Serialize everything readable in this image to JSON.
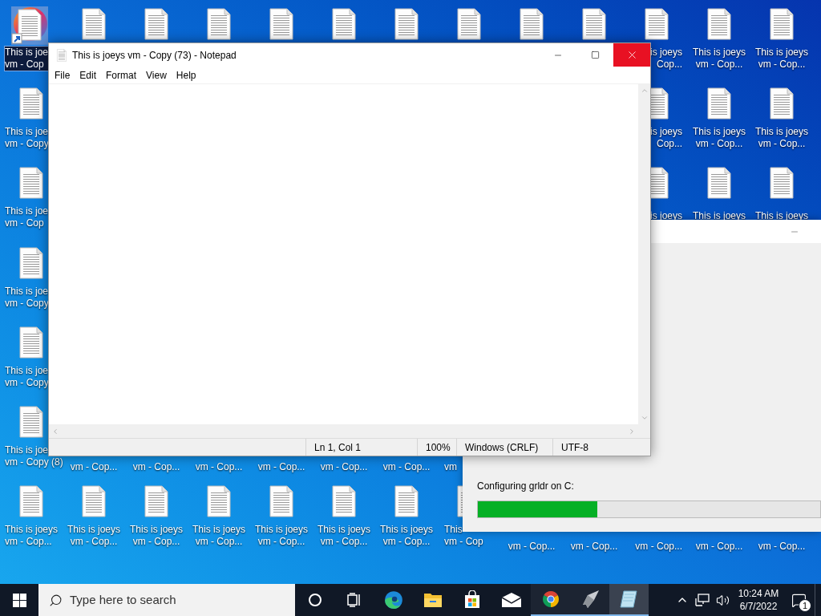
{
  "desktop": {
    "rows": [
      {
        "cells": [
          {
            "kind": "shortcut",
            "selected": true,
            "lines": [
              "This is joe",
              "vm - Cop"
            ]
          },
          {
            "kind": "file",
            "selected": false
          },
          {
            "kind": "file",
            "selected": false
          },
          {
            "kind": "file",
            "selected": false
          },
          {
            "kind": "file",
            "selected": false
          },
          {
            "kind": "file",
            "selected": false
          },
          {
            "kind": "file",
            "selected": false
          },
          {
            "kind": "file",
            "selected": false
          },
          {
            "kind": "file",
            "selected": false
          },
          {
            "kind": "file",
            "selected": false
          },
          {
            "kind": "file",
            "selected": false,
            "lines": [
              "is joeys",
              "Cop..."
            ]
          },
          {
            "kind": "file",
            "selected": false,
            "lines": [
              "This is joeys",
              "vm - Cop..."
            ]
          },
          {
            "kind": "file",
            "selected": false,
            "lines": [
              "This is joeys",
              "vm - Cop..."
            ]
          }
        ]
      },
      {
        "cells": [
          {
            "kind": "file",
            "selected": false,
            "lines": [
              "This is joe",
              "vm - Copy"
            ]
          },
          null,
          null,
          null,
          null,
          null,
          null,
          null,
          null,
          null,
          {
            "kind": "file",
            "selected": false,
            "lines": [
              "is joeys",
              "Cop..."
            ]
          },
          {
            "kind": "file",
            "selected": false,
            "lines": [
              "This is joeys",
              "vm - Cop..."
            ]
          },
          {
            "kind": "file",
            "selected": false,
            "lines": [
              "This is joeys",
              "vm - Cop..."
            ]
          }
        ]
      },
      {
        "cells": [
          {
            "kind": "file",
            "selected": false,
            "lines": [
              "This is joe",
              "vm - Cop"
            ]
          },
          null,
          null,
          null,
          null,
          null,
          null,
          null,
          null,
          null,
          {
            "kind": "file",
            "selected": false,
            "lines": [
              "is joeys"
            ]
          },
          {
            "kind": "file",
            "selected": false,
            "lines": [
              "This is joeys"
            ]
          },
          {
            "kind": "file",
            "selected": false,
            "lines": [
              "This is joeys"
            ]
          }
        ]
      },
      {
        "cells": [
          {
            "kind": "file",
            "selected": false,
            "lines": [
              "This is joe",
              "vm - Copy"
            ]
          }
        ]
      },
      {
        "cells": [
          {
            "kind": "file",
            "selected": false,
            "lines": [
              "This is joe",
              "vm - Copy"
            ]
          }
        ]
      },
      {
        "cells": [
          {
            "kind": "file",
            "selected": false,
            "lines": [
              "This is joe",
              "vm - Copy (8)"
            ]
          },
          {
            "kind": "tail",
            "selected": false,
            "lines": [
              "vm - Cop..."
            ]
          },
          {
            "kind": "tail",
            "selected": false,
            "lines": [
              "vm - Cop..."
            ]
          },
          {
            "kind": "tail",
            "selected": false,
            "lines": [
              "vm - Cop..."
            ]
          },
          {
            "kind": "tail",
            "selected": false,
            "lines": [
              "vm - Cop..."
            ]
          },
          {
            "kind": "tail",
            "selected": false,
            "lines": [
              "vm - Cop..."
            ]
          },
          {
            "kind": "tail",
            "selected": false,
            "lines": [
              "vm - Cop..."
            ]
          },
          {
            "kind": "tail",
            "selected": false,
            "lines": [
              "vm"
            ]
          }
        ]
      },
      {
        "cells": [
          {
            "kind": "file",
            "selected": false,
            "lines": [
              "This is joeys",
              "vm - Cop..."
            ]
          },
          {
            "kind": "file",
            "selected": false,
            "lines": [
              "This is joeys",
              "vm - Cop..."
            ]
          },
          {
            "kind": "file",
            "selected": false,
            "lines": [
              "This is joeys",
              "vm - Cop..."
            ]
          },
          {
            "kind": "file",
            "selected": false,
            "lines": [
              "This is joeys",
              "vm - Cop..."
            ]
          },
          {
            "kind": "file",
            "selected": false,
            "lines": [
              "This is joeys",
              "vm - Cop..."
            ]
          },
          {
            "kind": "file",
            "selected": false,
            "lines": [
              "This is joeys",
              "vm - Cop..."
            ]
          },
          {
            "kind": "file",
            "selected": false,
            "lines": [
              "This is joeys",
              "vm - Cop..."
            ]
          },
          {
            "kind": "file",
            "selected": false,
            "lines": [
              "This",
              "vm - Cop"
            ]
          },
          {
            "kind": "tail",
            "selected": false,
            "lines": [
              "vm - Cop..."
            ]
          },
          {
            "kind": "tail",
            "selected": false,
            "lines": [
              "vm - Cop..."
            ]
          },
          {
            "kind": "tail",
            "selected": false,
            "lines": [
              "vm - Cop..."
            ]
          },
          {
            "kind": "tail",
            "selected": false,
            "lines": [
              "vm - Cop..."
            ]
          },
          {
            "kind": "tail",
            "selected": false,
            "lines": [
              "vm - Cop..."
            ]
          }
        ]
      }
    ]
  },
  "progress_window": {
    "status": "Configuring grldr on C:",
    "level": 0.35
  },
  "notepad": {
    "title": "This is joeys vm - Copy (73) - Notepad",
    "menu": [
      "File",
      "Edit",
      "Format",
      "View",
      "Help"
    ],
    "status_bar": [
      "Ln 1, Col 1",
      "100%",
      "Windows (CRLF)",
      "UTF-8"
    ]
  },
  "taskbar": {
    "search": {
      "placeholder": "Type here to search"
    },
    "buttons": [
      {
        "kind": "cortana",
        "running": false,
        "active": false
      },
      {
        "kind": "task-view",
        "running": false,
        "active": false
      },
      {
        "kind": "edge",
        "running": false,
        "active": false
      },
      {
        "kind": "explorer",
        "running": false,
        "active": false
      },
      {
        "kind": "store",
        "running": false,
        "active": false
      },
      {
        "kind": "mail",
        "running": false,
        "active": false
      },
      {
        "kind": "chrome",
        "running": true,
        "active": false
      },
      {
        "kind": "rocket",
        "running": true,
        "active": false
      },
      {
        "kind": "notepad",
        "running": true,
        "active": true
      }
    ],
    "clock": {
      "time": "10:24 AM",
      "date": "6/7/2022"
    },
    "notifications": "1"
  }
}
